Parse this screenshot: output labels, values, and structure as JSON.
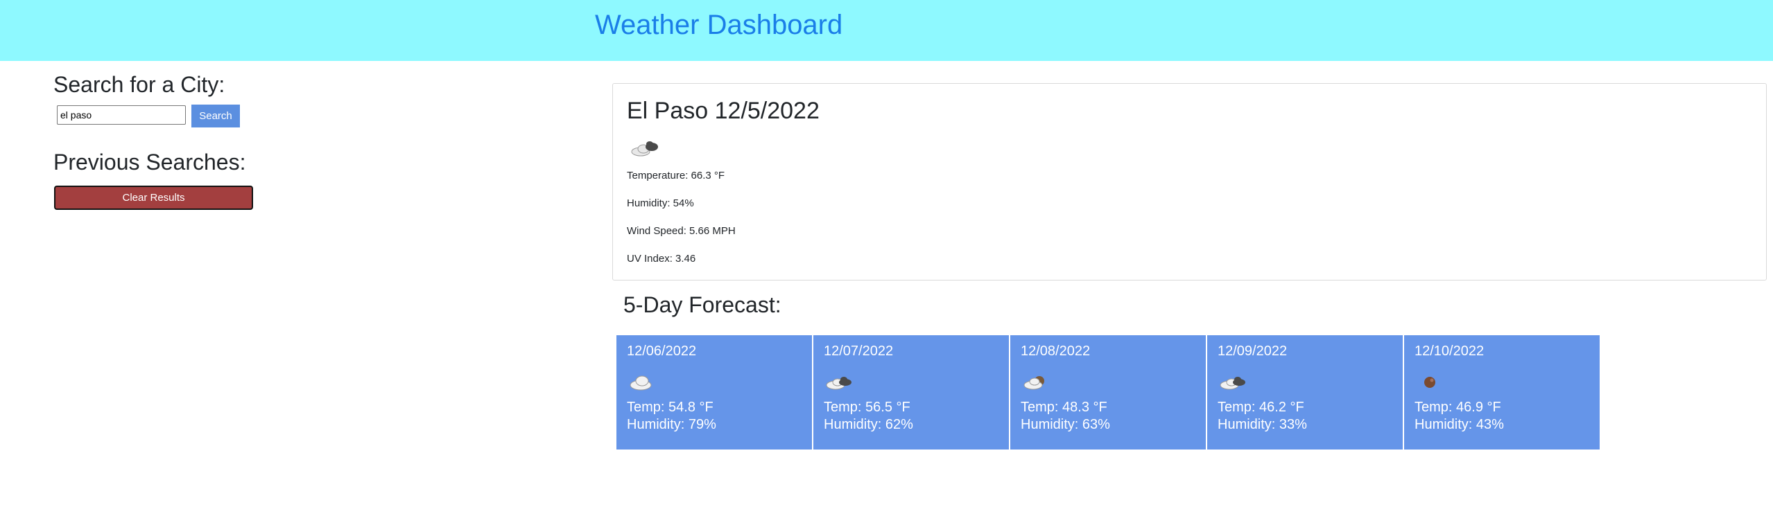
{
  "header": {
    "title": "Weather Dashboard"
  },
  "search": {
    "title": "Search for a City:",
    "input_value": "el paso",
    "button_label": "Search"
  },
  "previous": {
    "title": "Previous Searches:",
    "clear_label": "Clear Results"
  },
  "current": {
    "heading": "El Paso 12/5/2022",
    "icon": "cloud-dark-cloud-icon",
    "temperature": "Temperature: 66.3 °F",
    "humidity": "Humidity: 54%",
    "wind": "Wind Speed: 5.66 MPH",
    "uv": "UV Index: 3.46"
  },
  "forecast": {
    "title": "5-Day Forecast:",
    "days": [
      {
        "date": "12/06/2022",
        "icon": "cloud-icon",
        "temp": "Temp: 54.8 °F",
        "humidity": "Humidity: 79%"
      },
      {
        "date": "12/07/2022",
        "icon": "broken-clouds-icon",
        "temp": "Temp: 56.5 °F",
        "humidity": "Humidity: 62%"
      },
      {
        "date": "12/08/2022",
        "icon": "partly-cloudy-icon",
        "temp": "Temp: 48.3 °F",
        "humidity": "Humidity: 63%"
      },
      {
        "date": "12/09/2022",
        "icon": "broken-clouds-icon",
        "temp": "Temp: 46.2 °F",
        "humidity": "Humidity: 33%"
      },
      {
        "date": "12/10/2022",
        "icon": "sun-icon",
        "temp": "Temp: 46.9 °F",
        "humidity": "Humidity: 43%"
      }
    ]
  },
  "colors": {
    "header_bg": "#8ef9ff",
    "title_color": "#1a7ee8",
    "search_button": "#5b8fe0",
    "clear_button": "#a33f3f",
    "card_bg": "#6595e9"
  }
}
